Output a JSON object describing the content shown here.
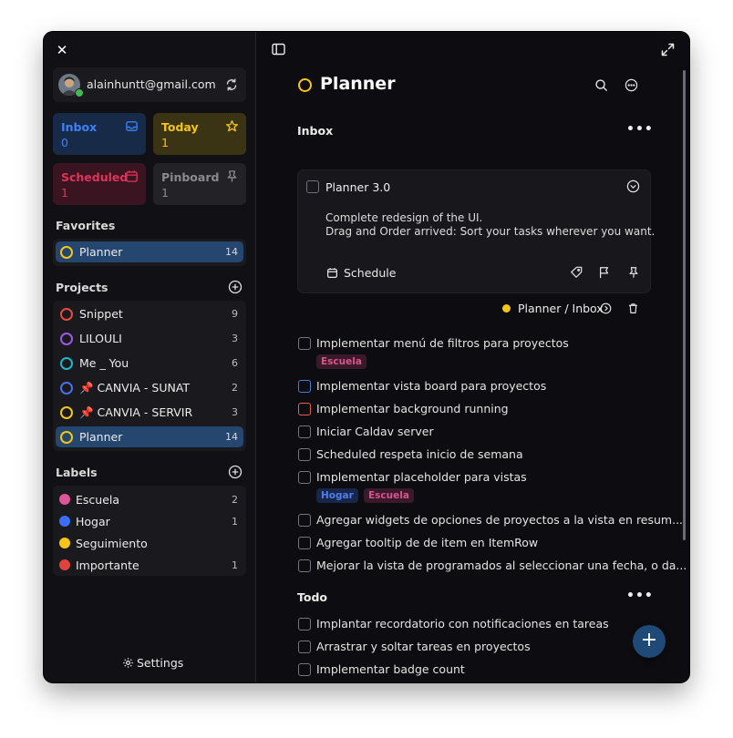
{
  "sidebar": {
    "account": {
      "email": "alainhuntt@gmail.com"
    },
    "tiles": [
      {
        "label": "Inbox",
        "count": "0",
        "color": "#3b82f6",
        "bg": "#172a47"
      },
      {
        "label": "Today",
        "count": "1",
        "color": "#f5c518",
        "bg": "#3a3414"
      },
      {
        "label": "Scheduled",
        "count": "1",
        "color": "#e0335a",
        "bg": "#3a1420"
      },
      {
        "label": "Pinboard",
        "count": "1",
        "color": "#8a8a8f",
        "bg": "#232327"
      }
    ],
    "favorites": {
      "title": "Favorites",
      "items": [
        {
          "label": "Planner",
          "count": "14",
          "color": "#f5c518"
        }
      ]
    },
    "projects": {
      "title": "Projects",
      "items": [
        {
          "label": "Snippet",
          "count": "9",
          "color": "#e74c3c"
        },
        {
          "label": "LILOULI",
          "count": "3",
          "color": "#9b59e6"
        },
        {
          "label": "Me _ You",
          "count": "6",
          "color": "#1fb5c8"
        },
        {
          "label": "📌 CANVIA - SUNAT",
          "count": "2",
          "color": "#4a6fe6"
        },
        {
          "label": "📌 CANVIA - SERVIR",
          "count": "3",
          "color": "#f5c518"
        },
        {
          "label": "Planner",
          "count": "14",
          "color": "#f5c518"
        }
      ]
    },
    "labels": {
      "title": "Labels",
      "items": [
        {
          "label": "Escuela",
          "count": "2",
          "color": "#e0559a"
        },
        {
          "label": "Hogar",
          "count": "1",
          "color": "#3b6ef5"
        },
        {
          "label": "Seguimiento",
          "count": "",
          "color": "#f5c518"
        },
        {
          "label": "Importante",
          "count": "1",
          "color": "#e0433b"
        }
      ]
    },
    "settings_label": "Settings"
  },
  "main": {
    "title": "Planner",
    "inbox_section": "Inbox",
    "card": {
      "title": "Planner 3.0",
      "description": "Complete redesign of the UI.\nDrag and Order arrived: Sort your tasks wherever you want.",
      "schedule_label": "Schedule"
    },
    "path": "Planner / Inbox",
    "tasks": [
      {
        "text": "Implementar menú de filtros para proyectos",
        "tags": [
          "Escuela"
        ],
        "cb": "#75757d"
      },
      {
        "text": "Implementar vista board para proyectos",
        "tags": [],
        "cb": "#4a78d6"
      },
      {
        "text": "Implementar background running",
        "tags": [],
        "cb": "#e06050"
      },
      {
        "text": "Iniciar Caldav server",
        "tags": [],
        "cb": "#75757d"
      },
      {
        "text": "Scheduled respeta inicio de semana",
        "tags": [],
        "cb": "#75757d"
      },
      {
        "text": "Implementar placeholder para vistas",
        "tags": [
          "Hogar",
          "Escuela"
        ],
        "cb": "#75757d"
      },
      {
        "text": "Agregar widgets de opciones de proyectos a la vista en resum...",
        "tags": [],
        "cb": "#75757d"
      },
      {
        "text": "Agregar tooltip de de item en ItemRow",
        "tags": [],
        "cb": "#75757d"
      },
      {
        "text": "Mejorar la vista de programados al seleccionar una fecha, o da...",
        "tags": [],
        "cb": "#75757d"
      }
    ],
    "todo_section": "Todo",
    "todo_tasks": [
      {
        "text": "Implantar recordatorio con notificaciones en tareas"
      },
      {
        "text": "Arrastrar y soltar tareas en proyectos"
      },
      {
        "text": "Implementar badge count"
      }
    ],
    "tag_colors": {
      "Escuela": {
        "fg": "#d9548d",
        "bg": "#3a1a2a"
      },
      "Hogar": {
        "fg": "#4f7df0",
        "bg": "#18264a"
      }
    }
  }
}
